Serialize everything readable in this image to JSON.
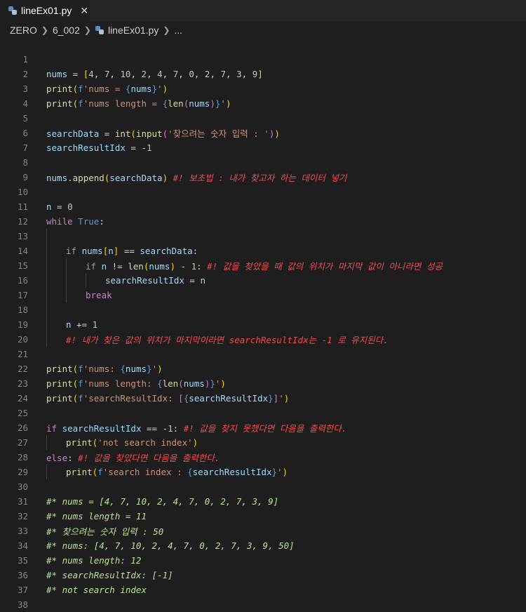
{
  "tab": {
    "filename": "lineEx01.py",
    "close_glyph": "✕"
  },
  "breadcrumb": {
    "items": [
      "ZERO",
      "6_002",
      "lineEx01.py",
      "..."
    ]
  },
  "lines": [
    {
      "n": "1",
      "indent": 0,
      "tokens": []
    },
    {
      "n": "2",
      "indent": 0,
      "tokens": [
        [
          "var",
          "nums"
        ],
        [
          "op",
          " = "
        ],
        [
          "brk",
          "["
        ],
        [
          "num",
          "4"
        ],
        [
          "pl",
          ", "
        ],
        [
          "num",
          "7"
        ],
        [
          "pl",
          ", "
        ],
        [
          "num",
          "10"
        ],
        [
          "pl",
          ", "
        ],
        [
          "num",
          "2"
        ],
        [
          "pl",
          ", "
        ],
        [
          "num",
          "4"
        ],
        [
          "pl",
          ", "
        ],
        [
          "num",
          "7"
        ],
        [
          "pl",
          ", "
        ],
        [
          "num",
          "0"
        ],
        [
          "pl",
          ", "
        ],
        [
          "num",
          "2"
        ],
        [
          "pl",
          ", "
        ],
        [
          "num",
          "7"
        ],
        [
          "pl",
          ", "
        ],
        [
          "num",
          "3"
        ],
        [
          "pl",
          ", "
        ],
        [
          "num",
          "9"
        ],
        [
          "brk",
          "]"
        ]
      ]
    },
    {
      "n": "3",
      "indent": 0,
      "tokens": [
        [
          "fn",
          "print"
        ],
        [
          "brk",
          "("
        ],
        [
          "sp",
          "f"
        ],
        [
          "str",
          "'nums = "
        ],
        [
          "sp",
          "{"
        ],
        [
          "var",
          "nums"
        ],
        [
          "sp",
          "}"
        ],
        [
          "str",
          "'"
        ],
        [
          "brk",
          ")"
        ]
      ]
    },
    {
      "n": "4",
      "indent": 0,
      "tokens": [
        [
          "fn",
          "print"
        ],
        [
          "brk",
          "("
        ],
        [
          "sp",
          "f"
        ],
        [
          "str",
          "'nums length = "
        ],
        [
          "sp",
          "{"
        ],
        [
          "fn",
          "len"
        ],
        [
          "brk2",
          "("
        ],
        [
          "var",
          "nums"
        ],
        [
          "brk2",
          ")"
        ],
        [
          "sp",
          "}"
        ],
        [
          "str",
          "'"
        ],
        [
          "brk",
          ")"
        ]
      ]
    },
    {
      "n": "5",
      "indent": 0,
      "tokens": []
    },
    {
      "n": "6",
      "indent": 0,
      "tokens": [
        [
          "var",
          "searchData"
        ],
        [
          "op",
          " = "
        ],
        [
          "fn",
          "int"
        ],
        [
          "brk",
          "("
        ],
        [
          "fn",
          "input"
        ],
        [
          "brk2",
          "("
        ],
        [
          "str",
          "'찾으려는 숫자 입력 : '"
        ],
        [
          "brk2",
          ")"
        ],
        [
          "brk",
          ")"
        ]
      ]
    },
    {
      "n": "7",
      "indent": 0,
      "tokens": [
        [
          "var",
          "searchResultIdx"
        ],
        [
          "op",
          " = "
        ],
        [
          "op",
          "-"
        ],
        [
          "num",
          "1"
        ]
      ]
    },
    {
      "n": "8",
      "indent": 0,
      "tokens": []
    },
    {
      "n": "9",
      "indent": 0,
      "tokens": [
        [
          "var",
          "nums"
        ],
        [
          "pl",
          "."
        ],
        [
          "fn",
          "append"
        ],
        [
          "brk",
          "("
        ],
        [
          "var",
          "searchData"
        ],
        [
          "brk",
          ")"
        ],
        [
          "pl",
          " "
        ],
        [
          "cmt-red",
          "#! 보초법 : 내가 찾고자 하는 데이터 넣기"
        ]
      ]
    },
    {
      "n": "10",
      "indent": 0,
      "tokens": []
    },
    {
      "n": "11",
      "indent": 0,
      "tokens": [
        [
          "var",
          "n"
        ],
        [
          "op",
          " = "
        ],
        [
          "num",
          "0"
        ]
      ]
    },
    {
      "n": "12",
      "indent": 0,
      "tokens": [
        [
          "kw",
          "while"
        ],
        [
          "pl",
          " "
        ],
        [
          "sp",
          "True"
        ],
        [
          "pl",
          ":"
        ]
      ]
    },
    {
      "n": "13",
      "indent": 1,
      "tokens": []
    },
    {
      "n": "14",
      "indent": 1,
      "tokens": [
        [
          "kw",
          "if"
        ],
        [
          "pl",
          " "
        ],
        [
          "var",
          "nums"
        ],
        [
          "brk",
          "["
        ],
        [
          "var",
          "n"
        ],
        [
          "brk",
          "]"
        ],
        [
          "op",
          " == "
        ],
        [
          "var",
          "searchData"
        ],
        [
          "pl",
          ":"
        ]
      ]
    },
    {
      "n": "15",
      "indent": 2,
      "tokens": [
        [
          "kw",
          "if"
        ],
        [
          "pl",
          " "
        ],
        [
          "var",
          "n"
        ],
        [
          "op",
          " != "
        ],
        [
          "fn",
          "len"
        ],
        [
          "brk",
          "("
        ],
        [
          "var",
          "nums"
        ],
        [
          "brk",
          ")"
        ],
        [
          "op",
          " - "
        ],
        [
          "num",
          "1"
        ],
        [
          "pl",
          ": "
        ],
        [
          "cmt-red",
          "#! 값을 찾았을 때 값의 위치가 마지막 값이 아니라면 성공"
        ]
      ]
    },
    {
      "n": "16",
      "indent": 3,
      "tokens": [
        [
          "var",
          "searchResultIdx"
        ],
        [
          "op",
          " = "
        ],
        [
          "var",
          "n"
        ]
      ]
    },
    {
      "n": "17",
      "indent": 2,
      "tokens": [
        [
          "kw",
          "break"
        ]
      ]
    },
    {
      "n": "18",
      "indent": 1,
      "tokens": []
    },
    {
      "n": "19",
      "indent": 1,
      "tokens": [
        [
          "var",
          "n"
        ],
        [
          "op",
          " += "
        ],
        [
          "num",
          "1"
        ]
      ]
    },
    {
      "n": "20",
      "indent": 1,
      "tokens": [
        [
          "cmt-red",
          "#! 내가 찾은 값의 위치가 마지막이라면 searchResultIdx는 -1 로 유지된다."
        ]
      ]
    },
    {
      "n": "21",
      "indent": 0,
      "tokens": []
    },
    {
      "n": "22",
      "indent": 0,
      "tokens": [
        [
          "fn",
          "print"
        ],
        [
          "brk",
          "("
        ],
        [
          "sp",
          "f"
        ],
        [
          "str",
          "'nums: "
        ],
        [
          "sp",
          "{"
        ],
        [
          "var",
          "nums"
        ],
        [
          "sp",
          "}"
        ],
        [
          "str",
          "'"
        ],
        [
          "brk",
          ")"
        ]
      ]
    },
    {
      "n": "23",
      "indent": 0,
      "tokens": [
        [
          "fn",
          "print"
        ],
        [
          "brk",
          "("
        ],
        [
          "sp",
          "f"
        ],
        [
          "str",
          "'nums length: "
        ],
        [
          "sp",
          "{"
        ],
        [
          "fn",
          "len"
        ],
        [
          "brk2",
          "("
        ],
        [
          "var",
          "nums"
        ],
        [
          "brk2",
          ")"
        ],
        [
          "sp",
          "}"
        ],
        [
          "str",
          "'"
        ],
        [
          "brk",
          ")"
        ]
      ]
    },
    {
      "n": "24",
      "indent": 0,
      "tokens": [
        [
          "fn",
          "print"
        ],
        [
          "brk",
          "("
        ],
        [
          "sp",
          "f"
        ],
        [
          "str",
          "'searchResultIdx: "
        ],
        [
          "brk2",
          "["
        ],
        [
          "sp",
          "{"
        ],
        [
          "var",
          "searchResultIdx"
        ],
        [
          "sp",
          "}"
        ],
        [
          "brk2",
          "]"
        ],
        [
          "str",
          "'"
        ],
        [
          "brk",
          ")"
        ]
      ]
    },
    {
      "n": "25",
      "indent": 0,
      "tokens": []
    },
    {
      "n": "26",
      "indent": 0,
      "tokens": [
        [
          "kw",
          "if"
        ],
        [
          "pl",
          " "
        ],
        [
          "var",
          "searchResultIdx"
        ],
        [
          "op",
          " == "
        ],
        [
          "op",
          "-"
        ],
        [
          "num",
          "1"
        ],
        [
          "pl",
          ": "
        ],
        [
          "cmt-red",
          "#! 값을 찾지 못했다면 다음을 출력한다."
        ]
      ]
    },
    {
      "n": "27",
      "indent": 1,
      "tokens": [
        [
          "fn",
          "print"
        ],
        [
          "brk",
          "("
        ],
        [
          "str",
          "'not search index'"
        ],
        [
          "brk",
          ")"
        ]
      ]
    },
    {
      "n": "28",
      "indent": 0,
      "tokens": [
        [
          "kw",
          "else"
        ],
        [
          "pl",
          ": "
        ],
        [
          "cmt-red",
          "#! 값을 찾았다면 다음을 출력한다."
        ]
      ]
    },
    {
      "n": "29",
      "indent": 1,
      "tokens": [
        [
          "fn",
          "print"
        ],
        [
          "brk",
          "("
        ],
        [
          "sp",
          "f"
        ],
        [
          "str",
          "'search index : "
        ],
        [
          "sp",
          "{"
        ],
        [
          "var",
          "searchResultIdx"
        ],
        [
          "sp",
          "}"
        ],
        [
          "str",
          "'"
        ],
        [
          "brk",
          ")"
        ]
      ]
    },
    {
      "n": "30",
      "indent": 0,
      "tokens": []
    },
    {
      "n": "31",
      "indent": 0,
      "tokens": [
        [
          "cmt-green",
          "#* nums = [4, 7, 10, 2, 4, 7, 0, 2, 7, 3, 9]"
        ]
      ]
    },
    {
      "n": "32",
      "indent": 0,
      "tokens": [
        [
          "cmt-green",
          "#* nums length = 11"
        ]
      ]
    },
    {
      "n": "33",
      "indent": 0,
      "tokens": [
        [
          "cmt-green",
          "#* 찾으려는 숫자 입력 : 50"
        ]
      ]
    },
    {
      "n": "34",
      "indent": 0,
      "tokens": [
        [
          "cmt-green",
          "#* nums: [4, 7, 10, 2, 4, 7, 0, 2, 7, 3, 9, 50]"
        ]
      ]
    },
    {
      "n": "35",
      "indent": 0,
      "tokens": [
        [
          "cmt-green",
          "#* nums length: 12"
        ]
      ]
    },
    {
      "n": "36",
      "indent": 0,
      "tokens": [
        [
          "cmt-green",
          "#* searchResultIdx: [-1]"
        ]
      ]
    },
    {
      "n": "37",
      "indent": 0,
      "tokens": [
        [
          "cmt-green",
          "#* not search index"
        ]
      ]
    },
    {
      "n": "38",
      "indent": 0,
      "tokens": []
    }
  ]
}
